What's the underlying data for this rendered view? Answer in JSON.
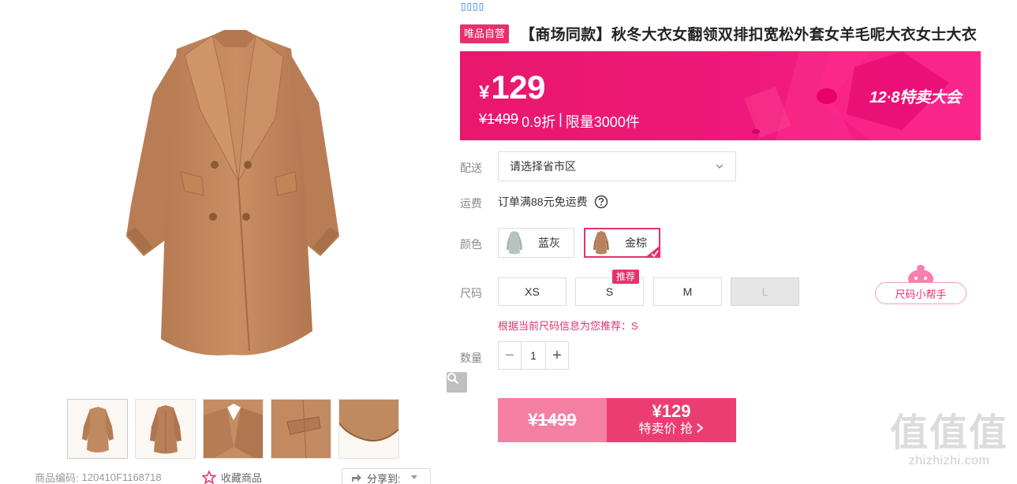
{
  "gallery": {
    "thumbnails": [
      "full-front-view",
      "full-back-view",
      "collar-detail",
      "pocket-detail",
      "hem-detail"
    ],
    "product_code_label": "商品编码:",
    "product_code": "120410F1168718",
    "favorite_label": "收藏商品",
    "share_label": "分享到:"
  },
  "header": {
    "top_icons": "▯▯▯▯",
    "badge": "唯品自营",
    "title": "【商场同款】秋冬大衣女翻领双排扣宽松外套女羊毛呢大衣女士大衣"
  },
  "price_banner": {
    "currency": "¥",
    "price": "129",
    "original_price": "¥1499",
    "discount": "0.9折",
    "separator": "|",
    "limit": "限量3000件",
    "sale_name": "12·8特卖大会"
  },
  "delivery": {
    "label": "配送",
    "placeholder": "请选择省市区"
  },
  "shipping": {
    "label": "运费",
    "text": "订单满88元免运费"
  },
  "colors": {
    "label": "颜色",
    "options": [
      {
        "name": "蓝灰",
        "swatch": "#b9c3be",
        "selected": false
      },
      {
        "name": "金棕",
        "swatch": "#b8825d",
        "selected": true
      }
    ]
  },
  "sizes": {
    "label": "尺码",
    "options": [
      "XS",
      "S",
      "M",
      "L"
    ],
    "recommended_tag": "推荐",
    "recommendation": "根据当前尺码信息为您推荐：S",
    "helper_label": "尺码小帮手"
  },
  "quantity": {
    "label": "数量",
    "value": "1",
    "minus": "−",
    "plus": "+"
  },
  "buy": {
    "original_price": "¥1499",
    "sale_price": "¥129",
    "action": "特卖价 抢"
  },
  "watermark": {
    "big": "值值值",
    "small": "zhizhizhi.com"
  },
  "colors_theme": {
    "brand_pink": "#e7306c",
    "banner_pink": "#f0187c",
    "coat_camel": "#c4895f"
  }
}
